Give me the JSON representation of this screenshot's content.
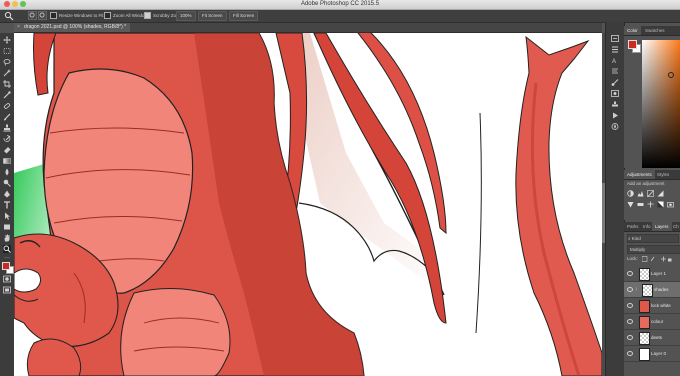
{
  "app": {
    "title": "Adobe Photoshop CC 2015.5"
  },
  "options_bar": {
    "resize_windows": "Resize Windows to Fit",
    "zoom_all_windows": "Zoom All Windows",
    "scrubby_zoom": "Scrubby Zoom",
    "zoom_value": "100%",
    "fit_screen": "Fit Screen",
    "fill_screen": "Fill Screen"
  },
  "document": {
    "tab_label": "dragon 2021.psd @ 100% (shades, RGB/8*) *"
  },
  "color_panel": {
    "tabs": [
      "Color",
      "Swatches"
    ],
    "foreground": "#cc2a1d",
    "background": "#ffffff"
  },
  "adjustments_panel": {
    "tabs": [
      "Adjustments",
      "Styles"
    ],
    "hint": "Add an adjustment"
  },
  "layers_panel": {
    "tabs": [
      "Paths",
      "Info",
      "Layers",
      "Ch"
    ],
    "filter": "Kind",
    "blend_mode": "Multiply",
    "lock_label": "Lock:",
    "layers": [
      {
        "name": "Layer 1",
        "selected": false
      },
      {
        "name": "shades",
        "selected": true
      },
      {
        "name": "lock white",
        "selected": false
      },
      {
        "name": "colour",
        "selected": false
      },
      {
        "name": "deets",
        "selected": false
      },
      {
        "name": "Layer 0",
        "selected": false
      }
    ]
  },
  "colors": {
    "dragon_red": "#dd5449",
    "dragon_dark_red": "#b93428",
    "belly_pink": "#f2857a",
    "wing_membrane": "#f5e3dd",
    "green_bg": "#4fd36a"
  }
}
